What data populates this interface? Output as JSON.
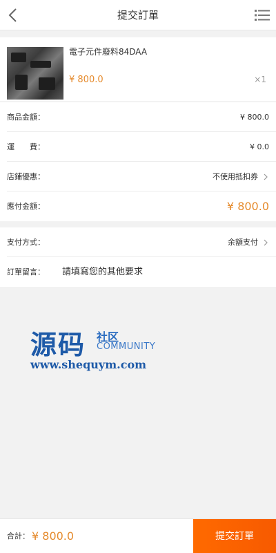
{
  "header": {
    "title": "提交訂單",
    "back_icon": "chevron-left-icon",
    "menu_icon": "list-menu-icon"
  },
  "product": {
    "name": "電子元件廢料84DAA",
    "price": "¥ 800.0",
    "qty": "×1"
  },
  "summary": {
    "rows": [
      {
        "label": "商品金額：",
        "value": "¥ 800.0"
      },
      {
        "label": "運　　費：",
        "value": "¥ 0.0"
      },
      {
        "label": "店鋪優惠：",
        "value": "不使用抵扣券"
      },
      {
        "label": "應付金額：",
        "value": "¥ 800.0"
      }
    ]
  },
  "payment": {
    "label": "支付方式：",
    "value": "余額支付",
    "remark_label": "訂單留言：",
    "remark_placeholder": "請填寫您的其他要求"
  },
  "watermark": {
    "big": "源码",
    "small": "社区",
    "eng": "COMMUNITY",
    "url": "www.shequym.com"
  },
  "footer": {
    "total_label": "合計：",
    "total_value": "¥ 800.0",
    "submit_label": "提交訂單"
  },
  "colors": {
    "accent": "#e58a2c",
    "submit": "#ff6a00",
    "watermark": "#1e5aa8"
  }
}
